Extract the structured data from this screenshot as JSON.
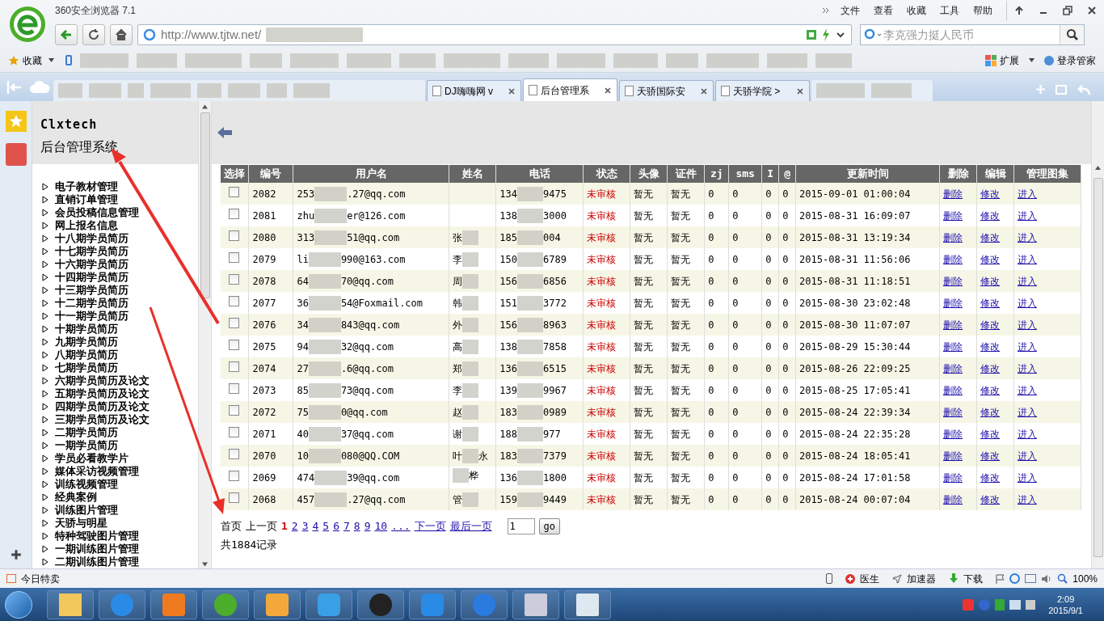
{
  "browser": {
    "title": "360安全浏览器 7.1",
    "menu": [
      "文件",
      "查看",
      "收藏",
      "工具",
      "帮助"
    ],
    "address": "http://www.tjtw.net/",
    "search": {
      "placeholder": "李克强力挺人民币"
    },
    "bookmarks": {
      "favorites": "收藏",
      "extensions": "扩展",
      "login_manager": "登录管家"
    },
    "tabs": [
      {
        "title": "DJ嗨嗨网 v",
        "selected": false
      },
      {
        "title": "后台管理系",
        "selected": true
      },
      {
        "title": "天骄国际安",
        "selected": false
      },
      {
        "title": "天骄学院 >",
        "selected": false
      }
    ]
  },
  "sidebar": {
    "brand": "Clxtech",
    "title": "后台管理系统",
    "items": [
      "电子教材管理",
      "直销订单管理",
      "会员投稿信息管理",
      "网上报名信息",
      "十八期学员简历",
      "十七期学员简历",
      "十六期学员简历",
      "十四期学员简历",
      "十三期学员简历",
      "十二期学员简历",
      "十一期学员简历",
      "十期学员简历",
      "九期学员简历",
      "八期学员简历",
      "七期学员简历",
      "六期学员简历及论文",
      "五期学员简历及论文",
      "四期学员简历及论文",
      "三期学员简历及论文",
      "二期学员简历",
      "一期学员简历",
      "学员必看教学片",
      "媒体采访视频管理",
      "训练视频管理",
      "经典案例",
      "训练图片管理",
      "天骄与明星",
      "特种驾驶图片管理",
      "一期训练图片管理",
      "二期训练图片管理"
    ]
  },
  "table": {
    "columns": [
      "选择",
      "编号",
      "用户名",
      "姓名",
      "电话",
      "状态",
      "头像",
      "证件",
      "zj",
      "sms",
      "I",
      "@",
      "更新时间",
      "删除",
      "编辑",
      "管理图集"
    ],
    "rows": [
      {
        "checked": false,
        "id": "2082",
        "user_start": "253",
        "user_end": ".27@qq.com",
        "phone_start": "134",
        "phone_end": "9475",
        "status": "未审核",
        "avatar": "暂无",
        "cert": "暂无",
        "zj": "0",
        "sms": "0",
        "col_i": "0",
        "at": "0",
        "updated": "2015-09-01 01:00:04",
        "delete": "删除",
        "edit": "修改",
        "enter": "进入"
      },
      {
        "checked": false,
        "id": "2081",
        "user_start": "zhu",
        "user_end": "er@126.com",
        "phone_start": "138",
        "phone_end": "3000",
        "status": "未审核",
        "avatar": "暂无",
        "cert": "暂无",
        "zj": "0",
        "sms": "0",
        "col_i": "0",
        "at": "0",
        "updated": "2015-08-31 16:09:07",
        "delete": "删除",
        "edit": "修改",
        "enter": "进入"
      },
      {
        "checked": false,
        "id": "2080",
        "user_start": "313",
        "user_end": "51@qq.com",
        "name_start": "张",
        "phone_start": "185",
        "phone_end": "004",
        "status": "未审核",
        "avatar": "暂无",
        "cert": "暂无",
        "zj": "0",
        "sms": "0",
        "col_i": "0",
        "at": "0",
        "updated": "2015-08-31 13:19:34",
        "delete": "删除",
        "edit": "修改",
        "enter": "进入"
      },
      {
        "checked": false,
        "id": "2079",
        "user_start": "li",
        "user_end": "990@163.com",
        "name_start": "李",
        "phone_start": "150",
        "phone_end": "6789",
        "status": "未审核",
        "avatar": "暂无",
        "cert": "暂无",
        "zj": "0",
        "sms": "0",
        "col_i": "0",
        "at": "0",
        "updated": "2015-08-31 11:56:06",
        "delete": "删除",
        "edit": "修改",
        "enter": "进入"
      },
      {
        "checked": false,
        "id": "2078",
        "user_start": "64",
        "user_end": "70@qq.com",
        "name_start": "周",
        "phone_start": "156",
        "phone_end": "6856",
        "status": "未审核",
        "avatar": "暂无",
        "cert": "暂无",
        "zj": "0",
        "sms": "0",
        "col_i": "0",
        "at": "0",
        "updated": "2015-08-31 11:18:51",
        "delete": "删除",
        "edit": "修改",
        "enter": "进入"
      },
      {
        "checked": false,
        "id": "2077",
        "user_start": "36",
        "user_end": "54@Foxmail.com",
        "name_start": "韩",
        "phone_start": "151",
        "phone_end": "3772",
        "status": "未审核",
        "avatar": "暂无",
        "cert": "暂无",
        "zj": "0",
        "sms": "0",
        "col_i": "0",
        "at": "0",
        "updated": "2015-08-30 23:02:48",
        "delete": "删除",
        "edit": "修改",
        "enter": "进入"
      },
      {
        "checked": false,
        "id": "2076",
        "user_start": "34",
        "user_end": "843@qq.com",
        "name_start": "外",
        "phone_start": "156",
        "phone_end": "8963",
        "status": "未审核",
        "avatar": "暂无",
        "cert": "暂无",
        "zj": "0",
        "sms": "0",
        "col_i": "0",
        "at": "0",
        "updated": "2015-08-30 11:07:07",
        "delete": "删除",
        "edit": "修改",
        "enter": "进入"
      },
      {
        "checked": false,
        "id": "2075",
        "user_start": "94",
        "user_end": "32@qq.com",
        "name_start": "高",
        "phone_start": "138",
        "phone_end": "7858",
        "status": "未审核",
        "avatar": "暂无",
        "cert": "暂无",
        "zj": "0",
        "sms": "0",
        "col_i": "0",
        "at": "0",
        "updated": "2015-08-29 15:30:44",
        "delete": "删除",
        "edit": "修改",
        "enter": "进入"
      },
      {
        "checked": false,
        "id": "2074",
        "user_start": "27",
        "user_end": ".6@qq.com",
        "name_start": "郑",
        "phone_start": "136",
        "phone_end": "6515",
        "status": "未审核",
        "avatar": "暂无",
        "cert": "暂无",
        "zj": "0",
        "sms": "0",
        "col_i": "0",
        "at": "0",
        "updated": "2015-08-26 22:09:25",
        "delete": "删除",
        "edit": "修改",
        "enter": "进入"
      },
      {
        "checked": false,
        "id": "2073",
        "user_start": "85",
        "user_end": "73@qq.com",
        "name_start": "李",
        "phone_start": "139",
        "phone_end": "9967",
        "status": "未审核",
        "avatar": "暂无",
        "cert": "暂无",
        "zj": "0",
        "sms": "0",
        "col_i": "0",
        "at": "0",
        "updated": "2015-08-25 17:05:41",
        "delete": "删除",
        "edit": "修改",
        "enter": "进入"
      },
      {
        "checked": false,
        "id": "2072",
        "user_start": "75",
        "user_end": "0@qq.com",
        "name_start": "赵",
        "phone_start": "183",
        "phone_end": "0989",
        "status": "未审核",
        "avatar": "暂无",
        "cert": "暂无",
        "zj": "0",
        "sms": "0",
        "col_i": "0",
        "at": "0",
        "updated": "2015-08-24 22:39:34",
        "delete": "删除",
        "edit": "修改",
        "enter": "进入"
      },
      {
        "checked": false,
        "id": "2071",
        "user_start": "40",
        "user_end": "37@qq.com",
        "name_start": "谢",
        "phone_start": "188",
        "phone_end": "977",
        "status": "未审核",
        "avatar": "暂无",
        "cert": "暂无",
        "zj": "0",
        "sms": "0",
        "col_i": "0",
        "at": "0",
        "updated": "2015-08-24 22:35:28",
        "delete": "删除",
        "edit": "修改",
        "enter": "进入"
      },
      {
        "checked": false,
        "id": "2070",
        "user_start": "10",
        "user_end": "080@QQ.COM",
        "name_start": "叶",
        "name_end": "永",
        "phone_start": "183",
        "phone_end": "7379",
        "status": "未审核",
        "avatar": "暂无",
        "cert": "暂无",
        "zj": "0",
        "sms": "0",
        "col_i": "0",
        "at": "0",
        "updated": "2015-08-24 18:05:41",
        "delete": "删除",
        "edit": "修改",
        "enter": "进入"
      },
      {
        "checked": false,
        "id": "2069",
        "user_start": "474",
        "user_end": "39@qq.com",
        "name_end": "桦",
        "phone_start": "136",
        "phone_end": "1800",
        "status": "未审核",
        "avatar": "暂无",
        "cert": "暂无",
        "zj": "0",
        "sms": "0",
        "col_i": "0",
        "at": "0",
        "updated": "2015-08-24 17:01:58",
        "delete": "删除",
        "edit": "修改",
        "enter": "进入"
      },
      {
        "checked": false,
        "id": "2068",
        "user_start": "457",
        "user_end": ".27@qq.com",
        "name_start": "管",
        "phone_start": "159",
        "phone_end": "9449",
        "status": "未审核",
        "avatar": "暂无",
        "cert": "暂无",
        "zj": "0",
        "sms": "0",
        "col_i": "0",
        "at": "0",
        "updated": "2015-08-24 00:07:04",
        "delete": "删除",
        "edit": "修改",
        "enter": "进入"
      }
    ]
  },
  "pagination": {
    "first": "首页",
    "prev": "上一页",
    "pages": [
      {
        "label": "1",
        "selected": true
      },
      {
        "label": "2",
        "selected": false
      },
      {
        "label": "3",
        "selected": false
      },
      {
        "label": "4",
        "selected": false
      },
      {
        "label": "5",
        "selected": false
      },
      {
        "label": "6",
        "selected": false
      },
      {
        "label": "7",
        "selected": false
      },
      {
        "label": "8",
        "selected": false
      },
      {
        "label": "9",
        "selected": false
      },
      {
        "label": "10",
        "selected": false
      },
      {
        "label": "...",
        "selected": false
      }
    ],
    "next": "下一页",
    "last": "最后一页",
    "page_input": "1",
    "go": "go",
    "total": "共1884记录"
  },
  "status_bar": {
    "deals": "今日特卖",
    "doctor": "医生",
    "accelerator": "加速器",
    "download": "下载",
    "zoom": "100%"
  },
  "taskbar": {
    "time": "2:09",
    "date": "2015/9/1"
  }
}
